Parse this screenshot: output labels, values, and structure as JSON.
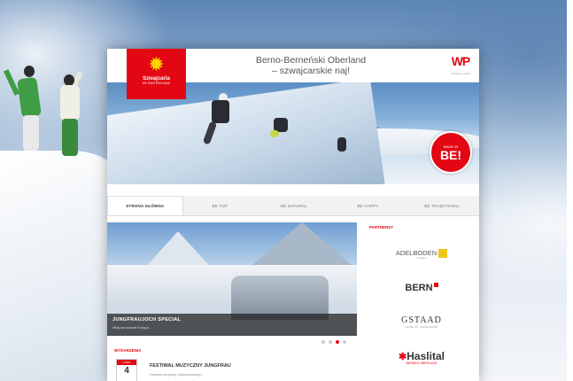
{
  "logo": {
    "brand": "Szwajcaria",
    "sub": "MY SWITZERLAND",
    "symbol": "✹"
  },
  "header": {
    "title_line1": "Berno-Berneński Oberland",
    "title_line2": "– szwajcarskie naj!",
    "wp_logo": "WP",
    "wp_sub": "wirtualna polska"
  },
  "hero": {
    "badge_top": "MADE IN",
    "badge_main": "BE!"
  },
  "nav": {
    "tabs": [
      "STRONA GŁÓWNA",
      "BE TOP",
      "BE NATURAL",
      "BE HAPPY",
      "BE TRADITIONAL"
    ],
    "active_index": 0
  },
  "feature": {
    "title": "JUNGFRAUJOCH SPECIAL",
    "description": "Witaj na szczycie Europy! ...",
    "slides": 4,
    "active_slide": 2
  },
  "events": {
    "heading": "WYDARZENIA",
    "month": "LIPIEC",
    "day": "4",
    "title": "FESTIWAL MUZYCZNY JUNGFRAU",
    "description": "Festiwal muzyczny, podczas którego ..."
  },
  "partners": {
    "heading": "PARTNERZY",
    "items": [
      {
        "name": "ADELBODEN",
        "sub": "Frutigen"
      },
      {
        "name": "BERN",
        "sub": ""
      },
      {
        "name": "GSTAAD",
        "sub": "COME UP - SLOW DOWN"
      },
      {
        "name": "Haslital",
        "sub": "BERNER OBERLAND"
      }
    ]
  },
  "colors": {
    "brand_red": "#e30613",
    "nav_bg": "#f2f2f2",
    "caption_bg": "#1e1e1e"
  }
}
